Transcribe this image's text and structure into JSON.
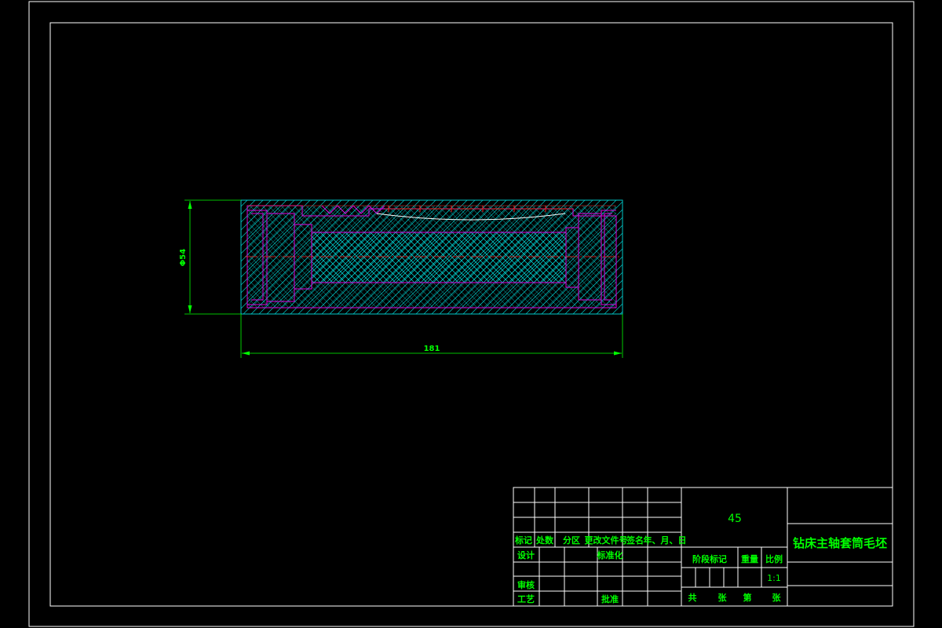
{
  "drawing": {
    "dimensions": {
      "diameter": "Φ54",
      "length": "181"
    }
  },
  "title_block": {
    "material": "45",
    "part_name": "钻床主轴套筒毛坯",
    "labels": {
      "biaoji": "标记",
      "chushu": "处数",
      "fenqu": "分区",
      "gengai": "更改文件号",
      "qianming": "签名",
      "date": "年、月、日",
      "sheji": "设计",
      "biaozhunhua": "标准化",
      "jieduan": "阶段标记",
      "zhongliang": "重量",
      "bili": "比例",
      "shenhe": "审核",
      "gongyi": "工艺",
      "pizhun": "批准",
      "gong": "共",
      "zhang1": "张",
      "di": "第",
      "zhang2": "张"
    },
    "scale": "1:1"
  },
  "colors": {
    "frame": "#ffffff",
    "outline": "#e000e0",
    "hatch": "#00c8c8",
    "dimension": "#00ff00",
    "centerline": "#ff2020",
    "text": "#00ff00"
  }
}
